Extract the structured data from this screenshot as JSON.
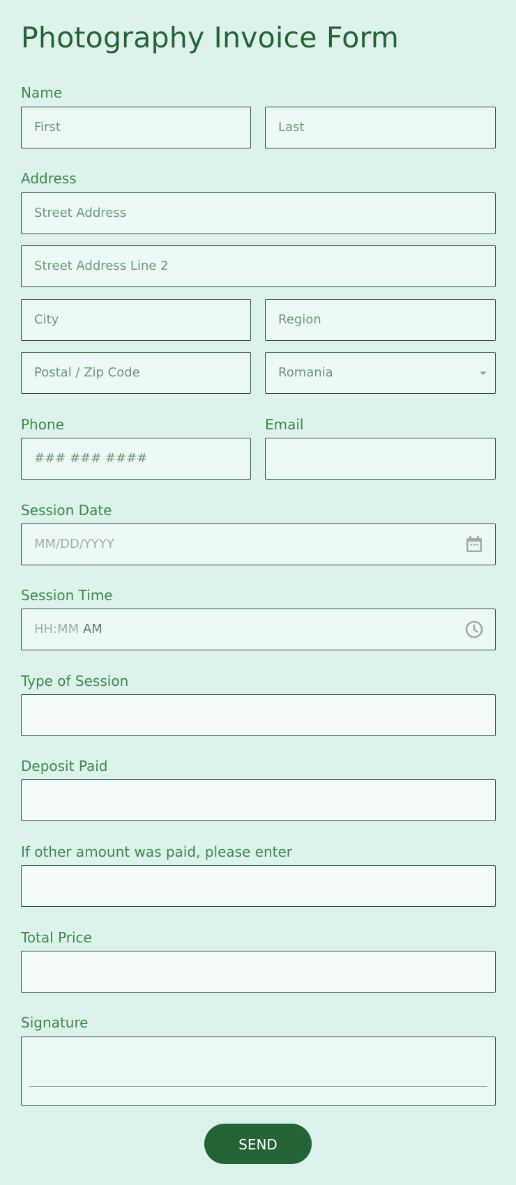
{
  "form": {
    "title": "Photography Invoice Form",
    "name": {
      "label": "Name",
      "first_placeholder": "First",
      "last_placeholder": "Last"
    },
    "address": {
      "label": "Address",
      "street_placeholder": "Street Address",
      "street2_placeholder": "Street Address Line 2",
      "city_placeholder": "City",
      "region_placeholder": "Region",
      "postal_placeholder": "Postal / Zip Code",
      "country_value": "Romania"
    },
    "phone": {
      "label": "Phone",
      "placeholder": "### ### ####"
    },
    "email": {
      "label": "Email",
      "value": ""
    },
    "session_date": {
      "label": "Session Date",
      "placeholder": "MM/DD/YYYY",
      "icon": "calendar-icon"
    },
    "session_time": {
      "label": "Session Time",
      "placeholder": "HH:MM",
      "ampm": "AM",
      "icon": "clock-icon"
    },
    "type_of_session": {
      "label": "Type of Session",
      "value": ""
    },
    "deposit_paid": {
      "label": "Deposit Paid",
      "value": ""
    },
    "other_amount": {
      "label": "If other amount was paid, please enter",
      "value": ""
    },
    "total_price": {
      "label": "Total Price",
      "value": ""
    },
    "signature": {
      "label": "Signature"
    },
    "send_label": "SEND"
  },
  "colors": {
    "background": "#dcf2ea",
    "title": "#236336",
    "label": "#3b8a4a",
    "button": "#236336"
  }
}
